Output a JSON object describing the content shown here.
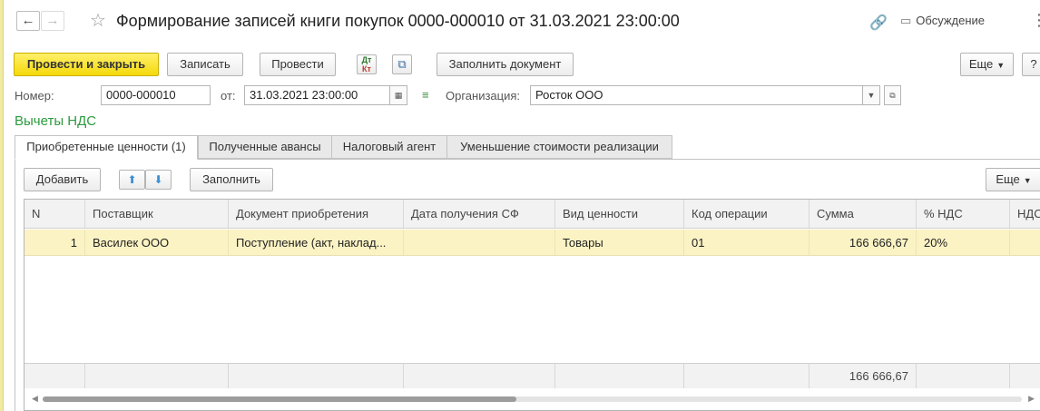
{
  "window": {
    "title": "Формирование записей книги покупок 0000-000010 от 31.03.2021 23:00:00",
    "back_icon": "←",
    "forward_icon": "→",
    "star_icon": "☆",
    "link_icon": "🔗",
    "discuss_icon": "▭",
    "discuss_label": "Обсуждение",
    "menu_icon": "⋮"
  },
  "toolbar": {
    "post_and_close": "Провести и закрыть",
    "save": "Записать",
    "post": "Провести",
    "dt_kt_top": "Дт",
    "dt_kt_bottom": "Кт",
    "fill_document": "Заполнить документ",
    "more": "Еще",
    "help": "?"
  },
  "form": {
    "number_label": "Номер:",
    "number_value": "0000-000010",
    "date_label": "от:",
    "date_value": "31.03.2021 23:00:00",
    "org_label": "Организация:",
    "org_value": "Росток ООО"
  },
  "section_title": "Вычеты НДС",
  "tabs": [
    {
      "label": "Приобретенные ценности (1)"
    },
    {
      "label": "Полученные авансы"
    },
    {
      "label": "Налоговый агент"
    },
    {
      "label": "Уменьшение стоимости реализации"
    }
  ],
  "table_toolbar": {
    "add": "Добавить",
    "fill": "Заполнить",
    "more": "Еще"
  },
  "table": {
    "columns": [
      "N",
      "Поставщик",
      "Документ приобретения",
      "Дата получения СФ",
      "Вид ценности",
      "Код операции",
      "Сумма",
      "% НДС",
      "НДС"
    ],
    "rows": [
      {
        "n": "1",
        "supplier": "Василек ООО",
        "document": "Поступление (акт, наклад...",
        "sf_date": "",
        "value_type": "Товары",
        "op_code": "01",
        "sum": "166 666,67",
        "vat_rate": "20%",
        "vat": ""
      }
    ],
    "footer": {
      "sum_total": "166 666,67"
    },
    "scroll_position": 0.48
  },
  "colors": {
    "primary_button": "#f5d90a",
    "section_title": "#2c9a3e",
    "selected_row": "#fbf3c4"
  }
}
